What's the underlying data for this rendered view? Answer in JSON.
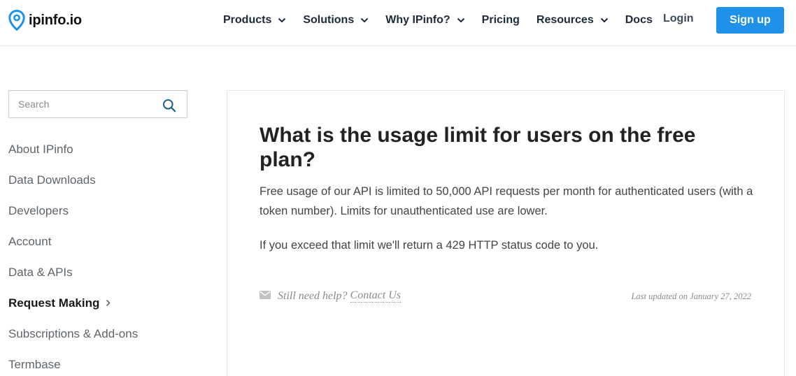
{
  "header": {
    "brand": "ipinfo.io",
    "logo_icon": "map-pin-icon",
    "nav": [
      {
        "label": "Products",
        "has_dropdown": true
      },
      {
        "label": "Solutions",
        "has_dropdown": true
      },
      {
        "label": "Why IPinfo?",
        "has_dropdown": true
      },
      {
        "label": "Pricing",
        "has_dropdown": false
      },
      {
        "label": "Resources",
        "has_dropdown": true
      },
      {
        "label": "Docs",
        "has_dropdown": false
      }
    ],
    "login_label": "Login",
    "signup_label": "Sign up"
  },
  "search": {
    "placeholder": "Search",
    "value": "",
    "icon": "search-icon"
  },
  "sidebar": {
    "items": [
      {
        "label": "About IPinfo",
        "active": false
      },
      {
        "label": "Data Downloads",
        "active": false
      },
      {
        "label": "Developers",
        "active": false
      },
      {
        "label": "Account",
        "active": false
      },
      {
        "label": "Data & APIs",
        "active": false
      },
      {
        "label": "Request Making",
        "active": true
      },
      {
        "label": "Subscriptions & Add-ons",
        "active": false
      },
      {
        "label": "Termbase",
        "active": false
      }
    ]
  },
  "article": {
    "title": "What is the usage limit for users on the free plan?",
    "paragraphs": [
      "Free usage of our API is limited to 50,000 API requests per month for authenticated users (with a token number). Limits for unauthenticated use are lower.",
      "If you exceed that limit we'll return a 429 HTTP status code to you."
    ],
    "help_text": "Still need help?",
    "help_link": "Contact Us",
    "help_icon": "envelope-icon",
    "last_updated": "Last updated on January 27, 2022"
  },
  "colors": {
    "brand_blue": "#1d92e8",
    "text_dark": "#1e2a3b",
    "text_muted": "#5e646b"
  }
}
